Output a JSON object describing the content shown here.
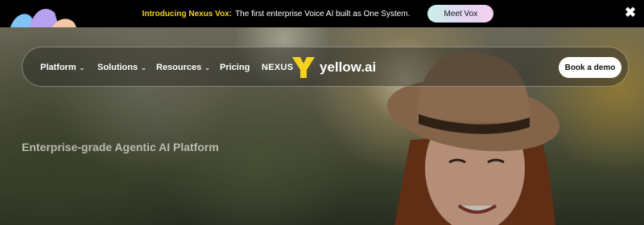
{
  "announcement": {
    "highlight": "Introducing Nexus Vox:",
    "text": "The first enterprise Voice AI built as One System.",
    "button_label": "Meet Vox",
    "close_glyph": "✖"
  },
  "nav": {
    "items": [
      {
        "label": "Platform",
        "chevron": "⌄"
      },
      {
        "label": "Solutions",
        "chevron": "⌄"
      },
      {
        "label": "Resources",
        "chevron": "⌄"
      },
      {
        "label": "Pricing"
      }
    ],
    "nexus_label": "NEXUS",
    "brand_name": "yellow.ai",
    "cta_label": "Book a demo"
  },
  "hero": {
    "tagline": "Enterprise-grade Agentic AI Platform"
  },
  "colors": {
    "accent_yellow": "#f4d21f",
    "announce_bg": "#000000"
  },
  "icons": [
    "brand-logo-icon",
    "close-icon",
    "chevron-down-icon"
  ]
}
